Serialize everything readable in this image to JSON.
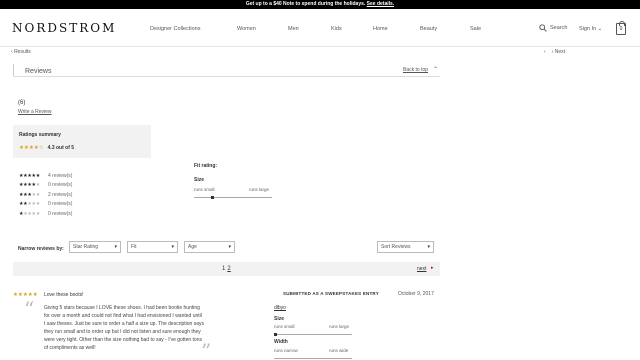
{
  "promo": {
    "text": "Get up to a $40 Note to spend during the holidays.",
    "link": "See details."
  },
  "header": {
    "logo": "NORDSTROM",
    "nav": [
      "Designer Collections",
      "Women",
      "Men",
      "Kids",
      "Home",
      "Beauty",
      "Sale"
    ],
    "search": "Search",
    "signin": "Sign In",
    "bag_count": "0"
  },
  "subnav": {
    "back": "Results",
    "next": "Next"
  },
  "reviews": {
    "title": "Reviews",
    "back_to_top": "Back to top",
    "count": "(6)",
    "write_review": "Write a Review",
    "summary_label": "Ratings summary",
    "summary_value": "4.3 out of 5",
    "summary_stars": 4.3,
    "distribution": [
      {
        "stars": 5,
        "label": "4 review(s)"
      },
      {
        "stars": 4,
        "label": "0 review(s)"
      },
      {
        "stars": 3,
        "label": "2 review(s)"
      },
      {
        "stars": 2,
        "label": "0 review(s)"
      },
      {
        "stars": 1,
        "label": "0 review(s)"
      }
    ],
    "fit_title": "Fit rating:",
    "fit_size": "Size",
    "fit_small": "runs small",
    "fit_large": "runs large",
    "fit_level": 0.22
  },
  "filters": {
    "label": "Narrow reviews by:",
    "star_rating": "Star Rating",
    "fit": "Fit",
    "age": "Age",
    "sort": "Sort Reviews"
  },
  "pager": {
    "current": "1",
    "page2": "2",
    "next": "next"
  },
  "review": {
    "stars": 5,
    "title": "Love these boots!",
    "body": "Giving 5 stars because I LOVE these shoes. I had been bootie hunting for over a month and could not find what I had envisioned I wanted until I saw theses. Just be sure to order a half a size up. The description says they run small and to order up but I did not listen and sure enough they were very tight. Other than the size nothing bad to say - I've gotten tons of compliments as well!",
    "sweepstakes": "SUBMITTED AS A SWEEPSTAKES ENTRY",
    "date": "October 9, 2017",
    "user": "dlbyo",
    "size": "Size",
    "runs_small": "runs small",
    "runs_large": "runs large",
    "width": "Width",
    "runs_narrow": "runs narrow",
    "runs_wide": "runs wide"
  },
  "colors": {
    "promo_bg": "#000000",
    "star_gold": "#d6a51f",
    "panel_bg": "#f2f2f2",
    "next_arrow": "#cc0000"
  }
}
